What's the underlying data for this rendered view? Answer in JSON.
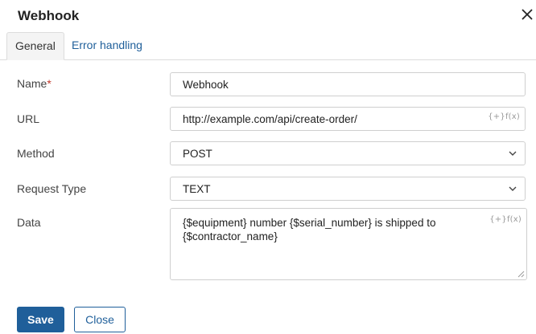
{
  "dialog": {
    "title": "Webhook",
    "close_icon": "close-icon"
  },
  "tabs": [
    {
      "label": "General",
      "active": true
    },
    {
      "label": "Error handling",
      "active": false
    }
  ],
  "form": {
    "name": {
      "label": "Name",
      "required_mark": "*",
      "value": "Webhook"
    },
    "url": {
      "label": "URL",
      "value": "http://example.com/api/create-order/",
      "addons": "{+}f(x)"
    },
    "method": {
      "label": "Method",
      "value": "POST"
    },
    "request_type": {
      "label": "Request Type",
      "value": "TEXT"
    },
    "data": {
      "label": "Data",
      "value": "{$equipment} number {$serial_number} is shipped to {$contractor_name}",
      "addons": "{+}f(x)"
    }
  },
  "buttons": {
    "save": "Save",
    "close": "Close"
  },
  "colors": {
    "accent": "#1f5f9a",
    "required": "#c0392b"
  }
}
